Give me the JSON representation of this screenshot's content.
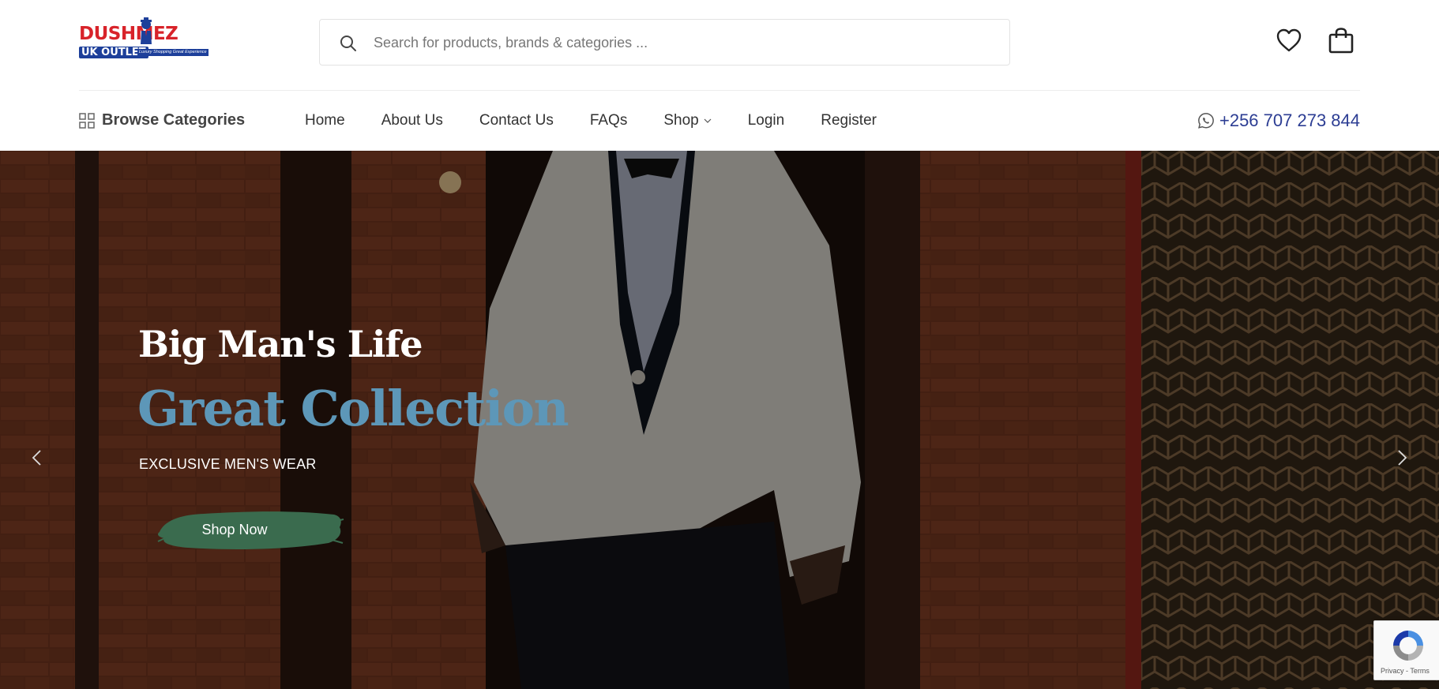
{
  "brand": {
    "logo_top": "DUSHMEZ",
    "logo_bottom": "UK OUTLET",
    "logo_tagline": "Luxury Shopping Great Experience",
    "primary_color": "#d8232a",
    "secondary_color": "#1d3f9a"
  },
  "search": {
    "placeholder": "Search for products, brands & categories ...",
    "value": "",
    "icon": "search-icon"
  },
  "header_icons": {
    "wishlist": "heart-icon",
    "cart": "shopping-bag-icon"
  },
  "nav": {
    "browse_label": "Browse Categories",
    "items": [
      {
        "label": "Home"
      },
      {
        "label": "About Us"
      },
      {
        "label": "Contact Us"
      },
      {
        "label": "FAQs"
      },
      {
        "label": "Shop",
        "has_dropdown": true
      },
      {
        "label": "Login"
      },
      {
        "label": "Register"
      }
    ],
    "phone": "+256 707 273 844",
    "phone_icon": "whatsapp-icon",
    "phone_color": "#2c3d93"
  },
  "hero": {
    "title_line1": "Big Man's Life",
    "title_line2": "Great Collection",
    "subtitle": "EXCLUSIVE MEN'S WEAR",
    "cta": "Shop Now",
    "accent_color": "#5d97b8",
    "cta_color": "#3a6b4e"
  },
  "recaptcha": {
    "text": "Privacy - Terms"
  }
}
